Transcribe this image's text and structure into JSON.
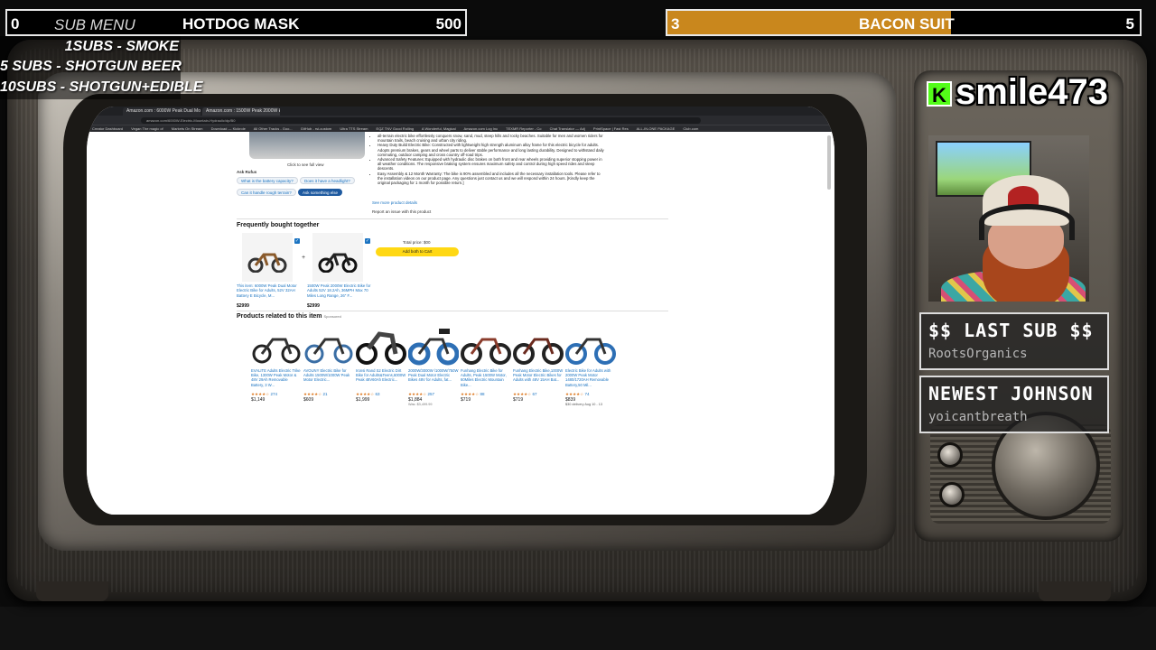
{
  "top_bars": {
    "left": {
      "count": "0",
      "label": "HOTDOG MASK",
      "goal": "500"
    },
    "right": {
      "count": "3",
      "label": "BACON SUIT",
      "goal": "5",
      "progress": 0.6
    }
  },
  "sub_menu": {
    "title": "SUB MENU",
    "items": [
      "1SUBS   - SMOKE",
      "5 SUBS  - SHOTGUN BEER",
      "10SUBS - SHOTGUN+EDIBLE"
    ]
  },
  "streamer": {
    "platform_icon": "kick-logo-icon",
    "platform_letter": "K",
    "name": "smile473"
  },
  "last_sub": {
    "title": "$$ LAST SUB $$",
    "value": "RootsOrganics"
  },
  "newest": {
    "title": "NEWEST JOHNSON",
    "value": "yoicantbreath"
  },
  "colors": {
    "progress": "#c9871d",
    "kick": "#53fc18",
    "amazon_button": "#ffd814",
    "link": "#1a73c1"
  },
  "browser": {
    "tabs": [
      "Amazon.com : 6000W Peak Dual Motor...",
      "Amazon.com : 1500W Peak 2000W Electric Bike Vehicle"
    ],
    "bookmarks": [
      "Creator Dashboard",
      "Vegan The magic of",
      "Markets On Stream",
      "Download — Kickrole",
      "All Other Tracks - Goo...",
      "GitHub - rsi-custom",
      "Ultra TTS Stream",
      "EQZ TNV Good Rolling",
      "A Wonderful, Magical",
      "Amazon.com Log Inc",
      "TEXMR Reporter - Co",
      "Chat Translator — Adj",
      "PrintSpace | Fast Res",
      "ALL-IN-ONE PACKAGE",
      "Club.com"
    ],
    "page": {
      "click_full_view": "Click to see full view",
      "ask_rufus": "Ask Rufus",
      "questions": [
        "What is the battery capacity?",
        "Does it have a headlight?",
        "Can it handle rough terrain?",
        "Ask something else"
      ],
      "bullets": [
        "all-terrain electric bike effortlessly conquers snow, sand, mud, steep hills and rocky beaches. Suitable for men and women riders for mountain trails, beach cruising and urban city riding.",
        "Heavy Duty Build Electric Bike: Constructed with lightweight high strength aluminum alloy frame for this electric bicycle for adults. Adopts premium brakes, gears and wheel parts to deliver stable performance and long lasting durability. Designed to withstand daily commuting, outdoor camping and cross country off-road trips.",
        "Advanced Safety Features: Equipped with hydraulic disc brakes on both front and rear wheels providing superior stopping power in all weather conditions. The responsive braking system ensures maximum safety and control during high speed rides and steep descents.",
        "Easy Assembly & 12 Month Warranty: The bike is 90% assembled and includes all the necessary installation tools. Please refer to the installation videos on our product page. Any questions just contact us and we will respond within 24 hours. [Kindly keep the original packaging for 1 month for possible return.]"
      ],
      "see_more": "See more product details",
      "report": "Report an issue with this product",
      "fbt_heading": "Frequently bought together",
      "fbt_items": [
        {
          "title": "This item: 6000W Peak Dual Motor Electric Bike for Adults, 52V 32AH Battery E Bicycle, M...",
          "price": "$2999"
        },
        {
          "title": "1500W Peak 2000W Electric Bike for Adults 52V 18.2Ah, 36MPH Max 70 Miles Long Range, 26\" F...",
          "price": "$2999"
        }
      ],
      "total_price": "Total price: $00",
      "add_to_cart": "Add both to Cart",
      "related_heading": "Products related to this item",
      "sponsored": "Sponsored",
      "related": [
        {
          "title": "EVALITE Adults Electric Trike Bike, 1300W Peak Motor & 48V 29Ah Removable Battery, 3 W...",
          "stars": "★★★★☆",
          "count": "274",
          "price": "$1,149"
        },
        {
          "title": "AVOUNY Electric Bike for Adults 1500W/1000W Peak Motor Electric...",
          "stars": "★★★★☆",
          "count": "21",
          "price": "$609"
        },
        {
          "title": "Ironsi Rand S2 Electric Dirt Bike for Adults&Teens,6000W Peak 48V60Ah Electric...",
          "stars": "★★★★☆",
          "count": "63",
          "price": "$1,999"
        },
        {
          "title": "2000W/3000W /1000W/750W Peak Dual Motor Electric Bikes 48V for Adults, fat...",
          "stars": "★★★★☆",
          "count": "257",
          "price": "$1,884"
        },
        {
          "title": "Funhang Electric Bike for Adults, Peak 1500W Motor, 60Miles Electric Mountain Bike...",
          "stars": "★★★★☆",
          "count": "88",
          "price": "$719"
        },
        {
          "title": "Funhang Electric Bike,1000W Peak Motor Electric Bikes for Adults with 48V 15AH Bat...",
          "stars": "★★★★☆",
          "count": "67",
          "price": "$719"
        },
        {
          "title": "Electric Bike for Adults with 2000W Peak Motor 1480/1720AH Removable Battery,50 Mil...",
          "stars": "★★★★☆",
          "count": "74",
          "price": "$839"
        }
      ],
      "delivery_note": "$30 delivery Aug 10 - 13",
      "list_note": "Was: $3,499.99"
    }
  }
}
